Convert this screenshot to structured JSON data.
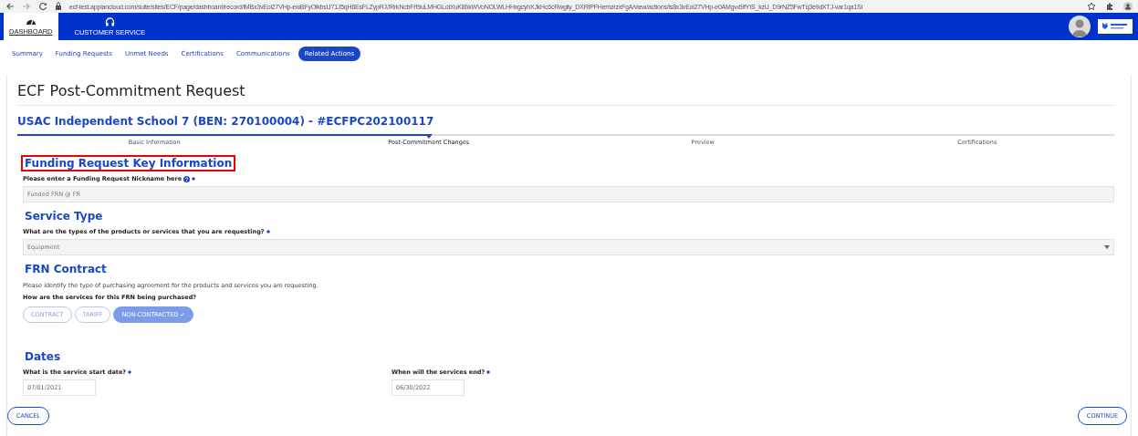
{
  "browser": {
    "url": "ecf-test.appiancloud.com/suite/sites/ECF/page/dashboard/record/lMBx3vEoi27VHp-ewBFyOlkbsU71J5qH6EsFLZypRJJRrkNcbFrf9uLMHGLotXuK8hkWVoNOLWLHHxgcyhXJkHc6cRwgliy_DXRtPFHemzrzxFgA/view/actions/is8x3vEoi27VHp-e0AMgvd9fYIS_kzU_D9rNZ5FwTq3e9dXTJ-var1qa1SI"
  },
  "nav": [
    {
      "label": "DASHBOARD",
      "selected": true
    },
    {
      "label": "CUSTOMER SERVICE",
      "selected": false
    }
  ],
  "tabs": [
    {
      "label": "Summary",
      "selected": false
    },
    {
      "label": "Funding Requests",
      "selected": false
    },
    {
      "label": "Unmet Needs",
      "selected": false
    },
    {
      "label": "Certifications",
      "selected": false
    },
    {
      "label": "Communications",
      "selected": false
    },
    {
      "label": "Related Actions",
      "selected": true
    }
  ],
  "page_title": "ECF Post-Commitment Request",
  "subtitle": "USAC Independent School 7 (BEN: 270100004) - #ECFPC202100117",
  "steps": [
    {
      "label": "Basic Information",
      "selected": false
    },
    {
      "label": "Post-Commitment Changes",
      "selected": true
    },
    {
      "label": "Preview",
      "selected": false
    },
    {
      "label": "Certifications",
      "selected": false
    }
  ],
  "sections": [
    {
      "heading": "Funding Request Key Information",
      "highlighted": true,
      "fields": [
        {
          "kind": "text",
          "label": "Please enter a Funding Request Nickname here",
          "help": true,
          "required": true,
          "value": "Funded FRN @ FR"
        }
      ]
    },
    {
      "heading": "Service Type",
      "highlighted": false,
      "fields": [
        {
          "kind": "select",
          "label": "What are the types of the products or services that you are requesting?",
          "required": true,
          "value": "Equipment"
        }
      ]
    },
    {
      "heading": "FRN Contract",
      "highlighted": false,
      "fields": [
        {
          "kind": "note",
          "label": "Please identify the type of purchasing agreement for the products and services you are requesting."
        },
        {
          "kind": "choice",
          "label": "How are the services for this FRN being purchased?",
          "options": [
            {
              "label": "CONTRACT",
              "selected": false
            },
            {
              "label": "TARIFF",
              "selected": false
            },
            {
              "label": "NON-CONTRACTED",
              "selected": true
            }
          ],
          "mark": "✓"
        }
      ]
    },
    {
      "heading": "Dates",
      "highlighted": false,
      "fields": [
        {
          "kind": "date",
          "label": "What is the service start date?",
          "required": true,
          "value": "07/01/2021"
        },
        {
          "kind": "date",
          "label": "When will the services end?",
          "required": true,
          "value": "06/30/2022"
        }
      ]
    }
  ],
  "buttons": [
    {
      "label": "CANCEL"
    },
    {
      "label": "CONTINUE"
    }
  ]
}
